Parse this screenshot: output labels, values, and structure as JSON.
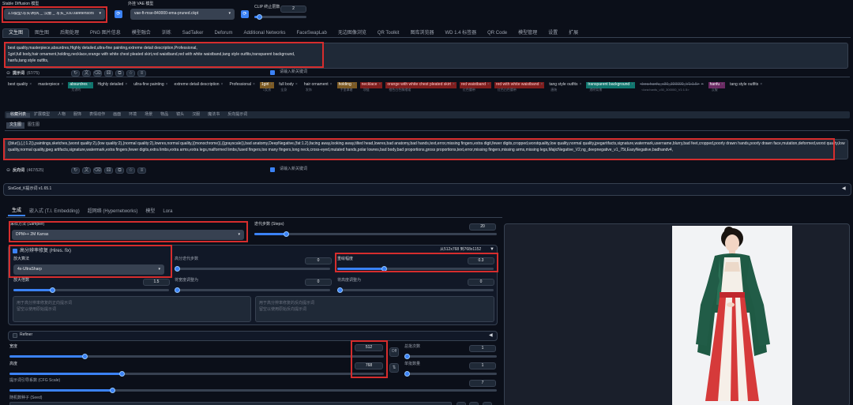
{
  "top": {
    "sd_model_label": "Stable Diffusion 模型",
    "sd_model_value": "1.5模型\\写实\\网风 _ 汉服 _ 写实_v30.safetensors",
    "vae_label": "外挂 VAE 模型",
    "vae_value": "vae-ft-mse-840000-ema-pruned.ckpt",
    "clip_label": "CLIP 终止层数",
    "clip_value": "2"
  },
  "tabs": [
    "文生图",
    "图生图",
    "后期处理",
    "PNG 图片信息",
    "模型融合",
    "训练",
    "SadTalker",
    "Deforum",
    "Additional Networks",
    "FaceSwapLab",
    "无边图像浏览",
    "QR Toolkit",
    "图库浏览器",
    "WD 1.4 标签器",
    "QR Code",
    "模型管理",
    "设置",
    "扩展"
  ],
  "prompt": {
    "text": "best quality,masterpiece,absurdres,Highly detailed,ultra-fine painting,extreme detail description,Professional,\n1girl,full body,hair ornament,holding,necklace,orange with white chest pleated skirt,red waistband,red with white waistband,tang style outfits,transparent background,\nhanfu,tang style outfits,",
    "label": "提示词",
    "count": "(67/75)",
    "input_placeholder": "请输入新关键词"
  },
  "tags": [
    {
      "t": "best quality",
      "s": ""
    },
    {
      "t": "masterpiece",
      "s": ""
    },
    {
      "t": "absurdres",
      "s": "荒谬的",
      "c": "c-teal"
    },
    {
      "t": "Highly detailed",
      "s": ""
    },
    {
      "t": "ultra-fine painting",
      "s": ""
    },
    {
      "t": "extreme detail description",
      "s": ""
    },
    {
      "t": "Professional",
      "s": ""
    },
    {
      "t": "1girl",
      "s": "1女孩",
      "c": "c-brown"
    },
    {
      "t": "full body",
      "s": "全身"
    },
    {
      "t": "hair ornament",
      "s": "发饰"
    },
    {
      "t": "holding",
      "s": "手里拿着",
      "c": "c-brown"
    },
    {
      "t": "necklace",
      "s": "项链",
      "c": "c-red"
    },
    {
      "t": "orange with white chest pleated skirt",
      "s": "橙色白色胸褶裙",
      "c": "c-red"
    },
    {
      "t": "red waistband",
      "s": "红色腰带",
      "c": "c-red"
    },
    {
      "t": "red with white waistband",
      "s": "红色白色腰带",
      "c": "c-red"
    },
    {
      "t": "tang style outfits",
      "s": "唐装"
    },
    {
      "t": "transparent background",
      "s": "透明背景",
      "c": "c-teal"
    },
    {
      "t": "<lora:hanfu_v30_300000_V1:1.5>",
      "s": "<lora:hanfu_v30_300000_V1:1.5>",
      "c": "c-strike"
    },
    {
      "t": "hanfu",
      "s": "汉服",
      "c": "c-purple"
    },
    {
      "t": "tang style outfits",
      "s": ""
    }
  ],
  "cat_tabs": [
    "收藏列表",
    "扩展模型",
    "人物",
    "服饰",
    "表情动作",
    "画面",
    "环境",
    "场景",
    "物品",
    "镜头",
    "汉服",
    "魔法书",
    "反向提示词"
  ],
  "sub_tabs": [
    "文生图",
    "图生图"
  ],
  "negative": {
    "text": "((blur)),(,(:1.2)),paintings,sketches,(worst quality:2),(low quality:2),(normal quality:2),lowres,normal quality,((monochrome)),((grayscale)),bad anatomy,DeepNegative,(fat:1.2),facing away,looking away,tilted head,lowres,bad anatomy,bad hands,text,error,missing fingers,extra digit,fewer digits,cropped,worstquality,low quality,normal quality,jpegartifacts,signature,watermark,username,blurry,bad feet,cropped,poorly drawn hands,poorly drawn face,mutation,deformed,worst quality,low quality,normal quality,jpeg artifacts,signature,watermark,extra fingers,fewer digits,extra limbs,extra arms,extra legs,malformed limbs,fused fingers,too many fingers,long neck,cross-eyed,mutated hands,polar lowres,bad body,bad proportions,gross proportions,text,error,missing fingers,missing arms,missing legs,MajicNegative_V2,ng_deepnegative_v1_75t,EasyNegative,badhandv4,",
    "label": "反向词",
    "count": "(467/525)",
    "input_placeholder": "请输入新关键词"
  },
  "sixgod": "SixGod_K提示词 v1.65.1",
  "gen_tabs": [
    "生成",
    "嵌入式 (T.I. Embedding)",
    "超网络 (Hypernetworks)",
    "模型",
    "Lora"
  ],
  "sampler": {
    "label": "采样方法 (Sampler)",
    "value": "DPM++ 2M Karras"
  },
  "steps": {
    "label": "迭代步数 (Steps)",
    "value": "20",
    "frac": 0.13
  },
  "hires": {
    "label": "高分辨率修复 (Hires. fix)",
    "resize_note": "从512x768 到768x1152",
    "upscaler_label": "放大算法",
    "upscaler_value": "4x-UltraSharp"
  },
  "hires_steps": {
    "label": "高分迭代步数",
    "value": "0",
    "frac": 0.0
  },
  "denoise": {
    "label": "重绘幅度",
    "value": "0.3",
    "frac": 0.3
  },
  "upscale_by": {
    "label": "放大倍数",
    "value": "1.5",
    "frac": 0.25
  },
  "resize_w": {
    "label": "将宽度调整为",
    "value": "0",
    "frac": 0.0
  },
  "resize_h": {
    "label": "将高度调整为",
    "value": "0",
    "frac": 0.0
  },
  "hires_prompt_ph": "用于高分辨率修复的正向提示词\n留空以使用原始提示词",
  "hires_neg_ph": "用于高分辨率修复的反向提示词\n留空以使用原始反向提示词",
  "refiner": {
    "label": "Refiner"
  },
  "width": {
    "label": "宽度",
    "value": "512",
    "frac": 0.2
  },
  "height": {
    "label": "高度",
    "value": "768",
    "frac": 0.3
  },
  "batch_count": {
    "label": "总批次数",
    "value": "1",
    "frac": 0.0
  },
  "batch_size": {
    "label": "单批数量",
    "value": "1",
    "frac": 0.0
  },
  "cfg": {
    "label": "提示词引导系数 (CFG Scale)",
    "value": "7",
    "frac": 0.21
  },
  "seed": {
    "label": "随机数种子 (Seed)"
  },
  "swap_label": "⇅",
  "off_label": "Off",
  "colors": {
    "accent": "#3b82f6",
    "highlight": "#d62d2d",
    "bg": "#0b0f19"
  }
}
